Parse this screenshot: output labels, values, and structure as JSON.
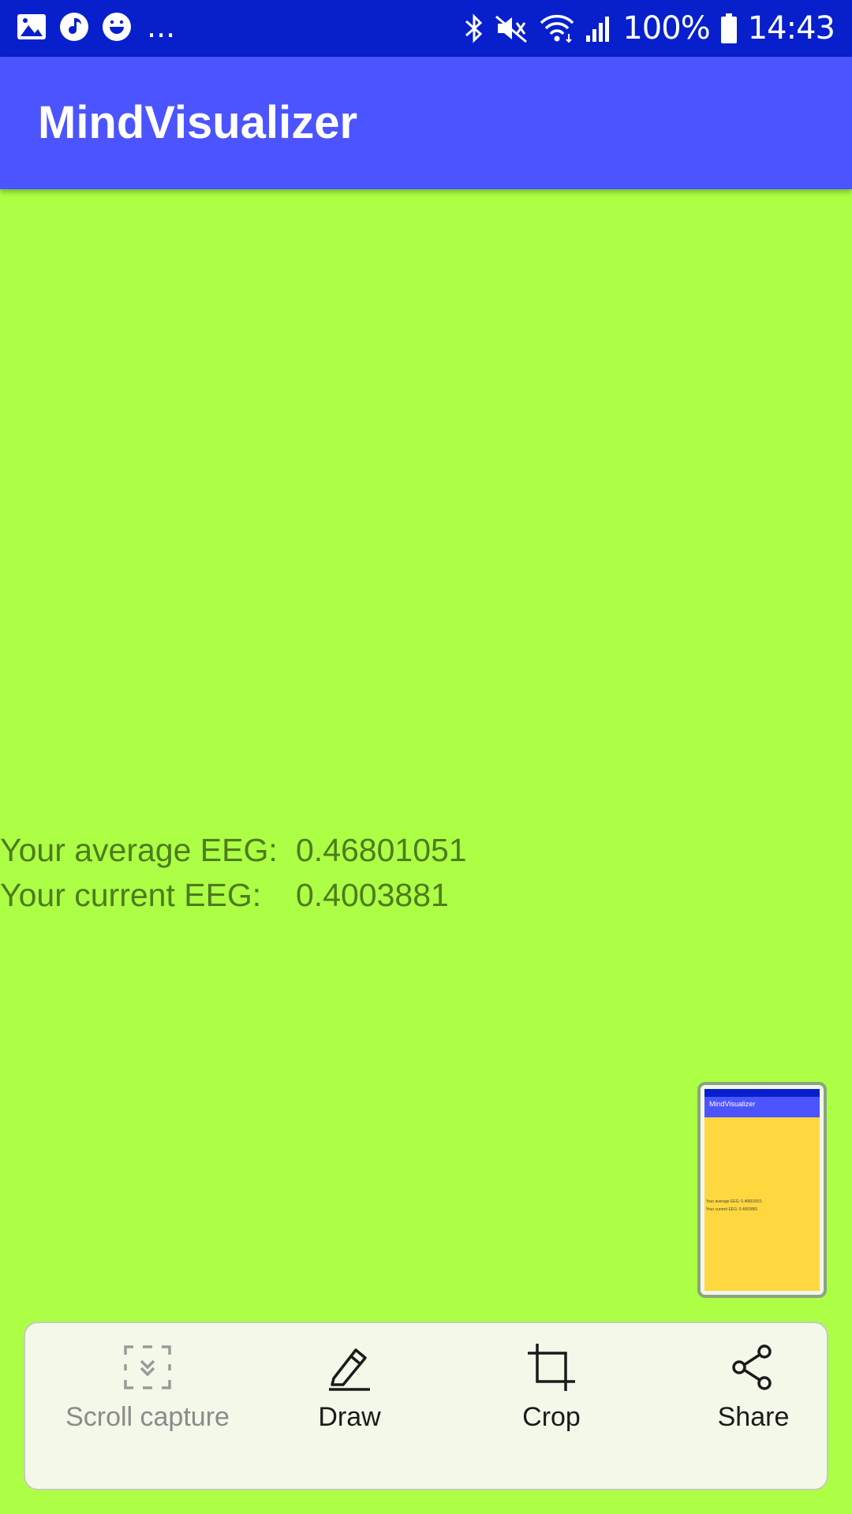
{
  "status_bar": {
    "left_icons": [
      "gallery-icon",
      "music-icon",
      "emoji-icon"
    ],
    "more": "...",
    "right_icons": [
      "bluetooth-icon",
      "mute-icon",
      "wifi-icon",
      "signal-icon",
      "battery-icon"
    ],
    "battery": "100%",
    "time": "14:43"
  },
  "app_bar": {
    "title": "MindVisualizer"
  },
  "eeg": {
    "average_label": "Your average EEG:",
    "average_value": "0.46801051",
    "current_label": "Your current EEG:",
    "current_value": "0.4003881"
  },
  "colors": {
    "status_bar": "#0720cc",
    "app_bar": "#4b54ff",
    "background": "#adff45",
    "eeg_text": "#4d7c1c",
    "thumbnail_background": "#ffd83f"
  },
  "screenshot_toolbar": {
    "scroll_capture": "Scroll capture",
    "draw": "Draw",
    "crop": "Crop",
    "share": "Share"
  }
}
